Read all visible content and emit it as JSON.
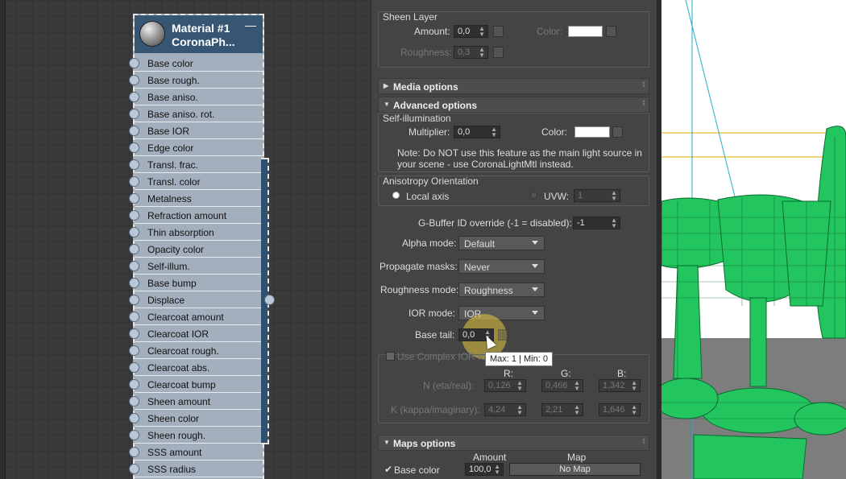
{
  "node_editor": {
    "node": {
      "title": "Material #1",
      "subtitle": "CoronaPh...",
      "collapse_glyph": "—",
      "slots": [
        "Base color",
        "Base rough.",
        "Base aniso.",
        "Base aniso. rot.",
        "Base IOR",
        "Edge color",
        "Transl. frac.",
        "Transl. color",
        "Metalness",
        "Refraction amount",
        "Thin absorption",
        "Opacity color",
        "Self-illum.",
        "Base bump",
        "Displace",
        "Clearcoat amount",
        "Clearcoat IOR",
        "Clearcoat rough.",
        "Clearcoat abs.",
        "Clearcoat bump",
        "Sheen amount",
        "Sheen color",
        "Sheen rough.",
        "SSS amount",
        "SSS radius"
      ]
    }
  },
  "props": {
    "sheen": {
      "group": "Sheen Layer",
      "amount_label": "Amount:",
      "amount_value": "0,0",
      "color_label": "Color:",
      "roughness_label": "Roughness:",
      "roughness_value": "0,3"
    },
    "rollouts": {
      "media": "Media options",
      "advanced": "Advanced options",
      "maps": "Maps options"
    },
    "selfillum": {
      "group": "Self-illumination",
      "multiplier_label": "Multiplier:",
      "multiplier_value": "0,0",
      "color_label": "Color:",
      "note_line1": "Note: Do NOT use this feature as the main light source in",
      "note_line2": "your scene - use CoronaLightMtl instead."
    },
    "anisotropy": {
      "group": "Anisotropy Orientation",
      "local_axis": "Local axis",
      "uvw_label": "UVW:",
      "uvw_value": "1"
    },
    "gbuffer": {
      "label": "G-Buffer ID override (-1 = disabled):",
      "value": "-1"
    },
    "alpha": {
      "label": "Alpha mode:",
      "value": "Default"
    },
    "propagate": {
      "label": "Propagate masks:",
      "value": "Never"
    },
    "roughness_mode": {
      "label": "Roughness mode:",
      "value": "Roughness"
    },
    "ior_mode": {
      "label": "IOR mode:",
      "value": "IOR"
    },
    "base_tail": {
      "label": "Base tail:",
      "value": "0,0"
    },
    "complex_ior": {
      "label": "Use Complex IOR for",
      "col_r": "R:",
      "col_g": "G:",
      "col_b": "B:",
      "n_label": "N (eta/real):",
      "n_r": "0,126",
      "n_g": "0,466",
      "n_b": "1,342",
      "k_label": "K (kappa/imaginary):",
      "k_r": "4,24",
      "k_g": "2,21",
      "k_b": "1,646"
    },
    "tooltip": "Max: 1 | Min: 0",
    "maps": {
      "amount_header": "Amount",
      "map_header": "Map",
      "row_label": "Base color",
      "row_amount": "100,0",
      "row_map": "No Map"
    }
  }
}
